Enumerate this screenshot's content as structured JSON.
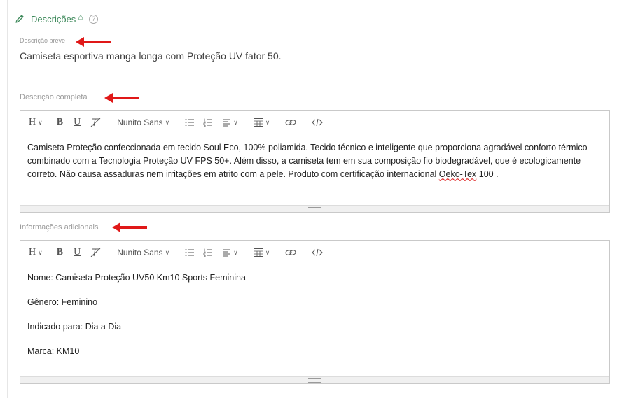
{
  "section": {
    "title": "Descrições",
    "help": "?"
  },
  "short_description": {
    "label": "Descrição breve",
    "value": "Camiseta esportiva manga longa com Proteção UV fator 50."
  },
  "toolbar": {
    "heading": "H",
    "bold": "B",
    "underline": "U",
    "font": "Nunito Sans"
  },
  "full_description": {
    "label": "Descrição completa",
    "text_before": "Camiseta Proteção confeccionada em tecido Soul Eco, 100% poliamida. Tecido técnico e inteligente que proporciona agradável conforto térmico combinado com a Tecnologia Proteção UV FPS 50+. Além disso, a camiseta tem em sua composição fio biodegradável, que é ecologicamente correto. Não causa assaduras nem irritações em atrito com a pele. Produto com certificação internacional ",
    "text_flag": "Oeko-Tex",
    "text_after": " 100 ."
  },
  "additional_info": {
    "label": "Informações adicionais",
    "lines": [
      "Nome: Camiseta Proteção UV50 Km10 Sports Feminina",
      "Gênero: Feminino",
      "Indicado para: Dia a Dia",
      "Marca: KM10"
    ]
  },
  "colors": {
    "accent": "#3f8a5c",
    "arrow": "#e01818"
  }
}
